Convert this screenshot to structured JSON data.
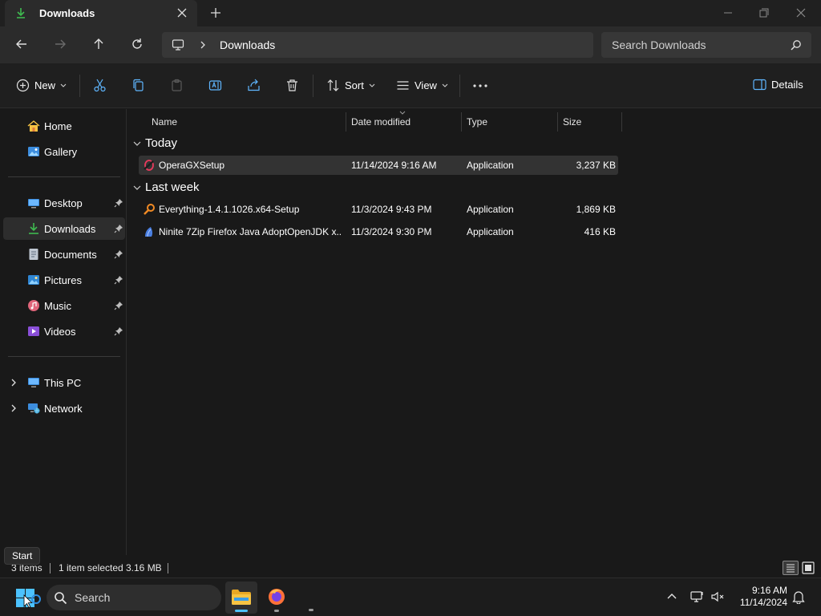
{
  "window": {
    "tab_title": "Downloads"
  },
  "nav": {
    "breadcrumb": "Downloads",
    "search_placeholder": "Search Downloads"
  },
  "commandbar": {
    "new_label": "New",
    "sort_label": "Sort",
    "view_label": "View",
    "details_label": "Details"
  },
  "sidebar": {
    "quick": [
      {
        "label": "Home",
        "icon": "home-icon"
      },
      {
        "label": "Gallery",
        "icon": "gallery-icon"
      }
    ],
    "pinned": [
      {
        "label": "Desktop",
        "icon": "desktop-icon"
      },
      {
        "label": "Downloads",
        "icon": "downloads-icon"
      },
      {
        "label": "Documents",
        "icon": "documents-icon"
      },
      {
        "label": "Pictures",
        "icon": "pictures-icon"
      },
      {
        "label": "Music",
        "icon": "music-icon"
      },
      {
        "label": "Videos",
        "icon": "videos-icon"
      }
    ],
    "locations": [
      {
        "label": "This PC",
        "icon": "this-pc-icon"
      },
      {
        "label": "Network",
        "icon": "network-icon"
      }
    ],
    "selected": "Downloads"
  },
  "columns": {
    "name": "Name",
    "date": "Date modified",
    "type": "Type",
    "size": "Size"
  },
  "groups": [
    {
      "label": "Today",
      "files": [
        {
          "name": "OperaGXSetup",
          "date": "11/14/2024 9:16 AM",
          "type": "Application",
          "size": "3,237 KB",
          "icon": "opera-gx-icon",
          "selected": true
        }
      ]
    },
    {
      "label": "Last week",
      "files": [
        {
          "name": "Everything-1.4.1.1026.x64-Setup",
          "date": "11/3/2024 9:43 PM",
          "type": "Application",
          "size": "1,869 KB",
          "icon": "everything-search-icon",
          "selected": false
        },
        {
          "name": "Ninite 7Zip Firefox Java AdoptOpenJDK x...",
          "date": "11/3/2024 9:30 PM",
          "type": "Application",
          "size": "416 KB",
          "icon": "ninite-icon",
          "selected": false
        }
      ]
    }
  ],
  "status": {
    "items": "3 items",
    "selection": "1 item selected",
    "size": "3.16 MB"
  },
  "tooltip": "Start",
  "taskbar": {
    "search_label": "Search",
    "time": "9:16 AM",
    "date": "11/14/2024"
  },
  "colors": {
    "accent": "#4cc2ff",
    "folder_yellow": "#f6c343",
    "downloads_green": "#3fb950"
  }
}
